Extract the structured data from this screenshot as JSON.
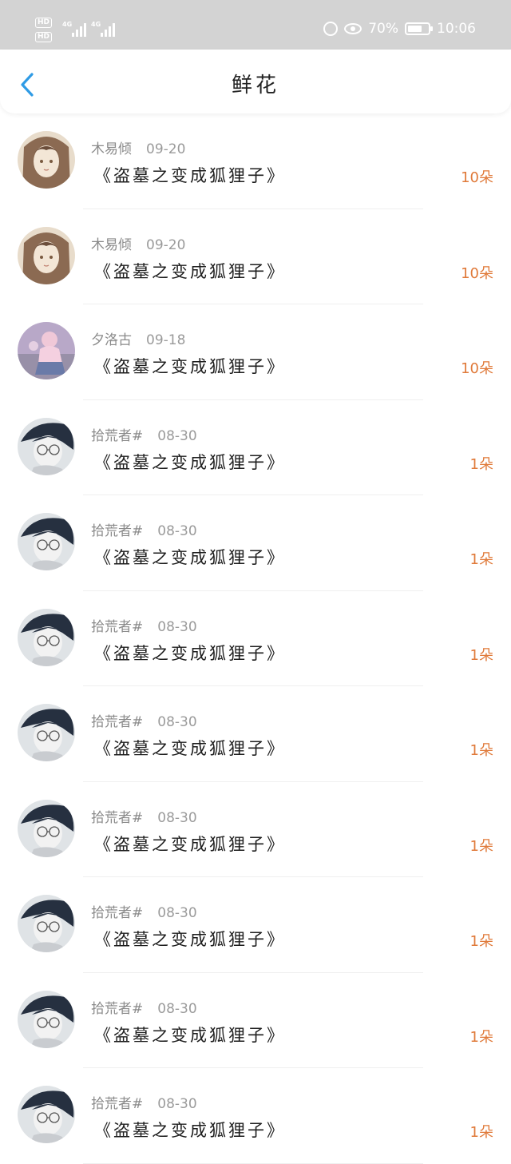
{
  "status_bar": {
    "battery_percent": "70%",
    "time": "10:06",
    "net_1": "4G",
    "net_2": "4G",
    "hd_1": "HD",
    "hd_2": "HD",
    "battery_level": 0.7
  },
  "header": {
    "title": "鲜花"
  },
  "colors": {
    "count_color": "#e07a3a",
    "back_arrow_color": "#2f9be5",
    "status_bar_bg": "#d3d3d3"
  },
  "rows": [
    {
      "user": "木易倾",
      "date": "09-20",
      "book": "《盗墓之变成狐狸子》",
      "count": "10朵",
      "avatar": "avatar-girl-sketch"
    },
    {
      "user": "木易倾",
      "date": "09-20",
      "book": "《盗墓之变成狐狸子》",
      "count": "10朵",
      "avatar": "avatar-girl-sketch"
    },
    {
      "user": "夕洛古",
      "date": "09-18",
      "book": "《盗墓之变成狐狸子》",
      "count": "10朵",
      "avatar": "avatar-girl-pink"
    },
    {
      "user": "拾荒者#",
      "date": "08-30",
      "book": "《盗墓之变成狐狸子》",
      "count": "1朵",
      "avatar": "avatar-boy-glasses"
    },
    {
      "user": "拾荒者#",
      "date": "08-30",
      "book": "《盗墓之变成狐狸子》",
      "count": "1朵",
      "avatar": "avatar-boy-glasses"
    },
    {
      "user": "拾荒者#",
      "date": "08-30",
      "book": "《盗墓之变成狐狸子》",
      "count": "1朵",
      "avatar": "avatar-boy-glasses"
    },
    {
      "user": "拾荒者#",
      "date": "08-30",
      "book": "《盗墓之变成狐狸子》",
      "count": "1朵",
      "avatar": "avatar-boy-glasses"
    },
    {
      "user": "拾荒者#",
      "date": "08-30",
      "book": "《盗墓之变成狐狸子》",
      "count": "1朵",
      "avatar": "avatar-boy-glasses"
    },
    {
      "user": "拾荒者#",
      "date": "08-30",
      "book": "《盗墓之变成狐狸子》",
      "count": "1朵",
      "avatar": "avatar-boy-glasses"
    },
    {
      "user": "拾荒者#",
      "date": "08-30",
      "book": "《盗墓之变成狐狸子》",
      "count": "1朵",
      "avatar": "avatar-boy-glasses"
    },
    {
      "user": "拾荒者#",
      "date": "08-30",
      "book": "《盗墓之变成狐狸子》",
      "count": "1朵",
      "avatar": "avatar-boy-glasses"
    }
  ]
}
